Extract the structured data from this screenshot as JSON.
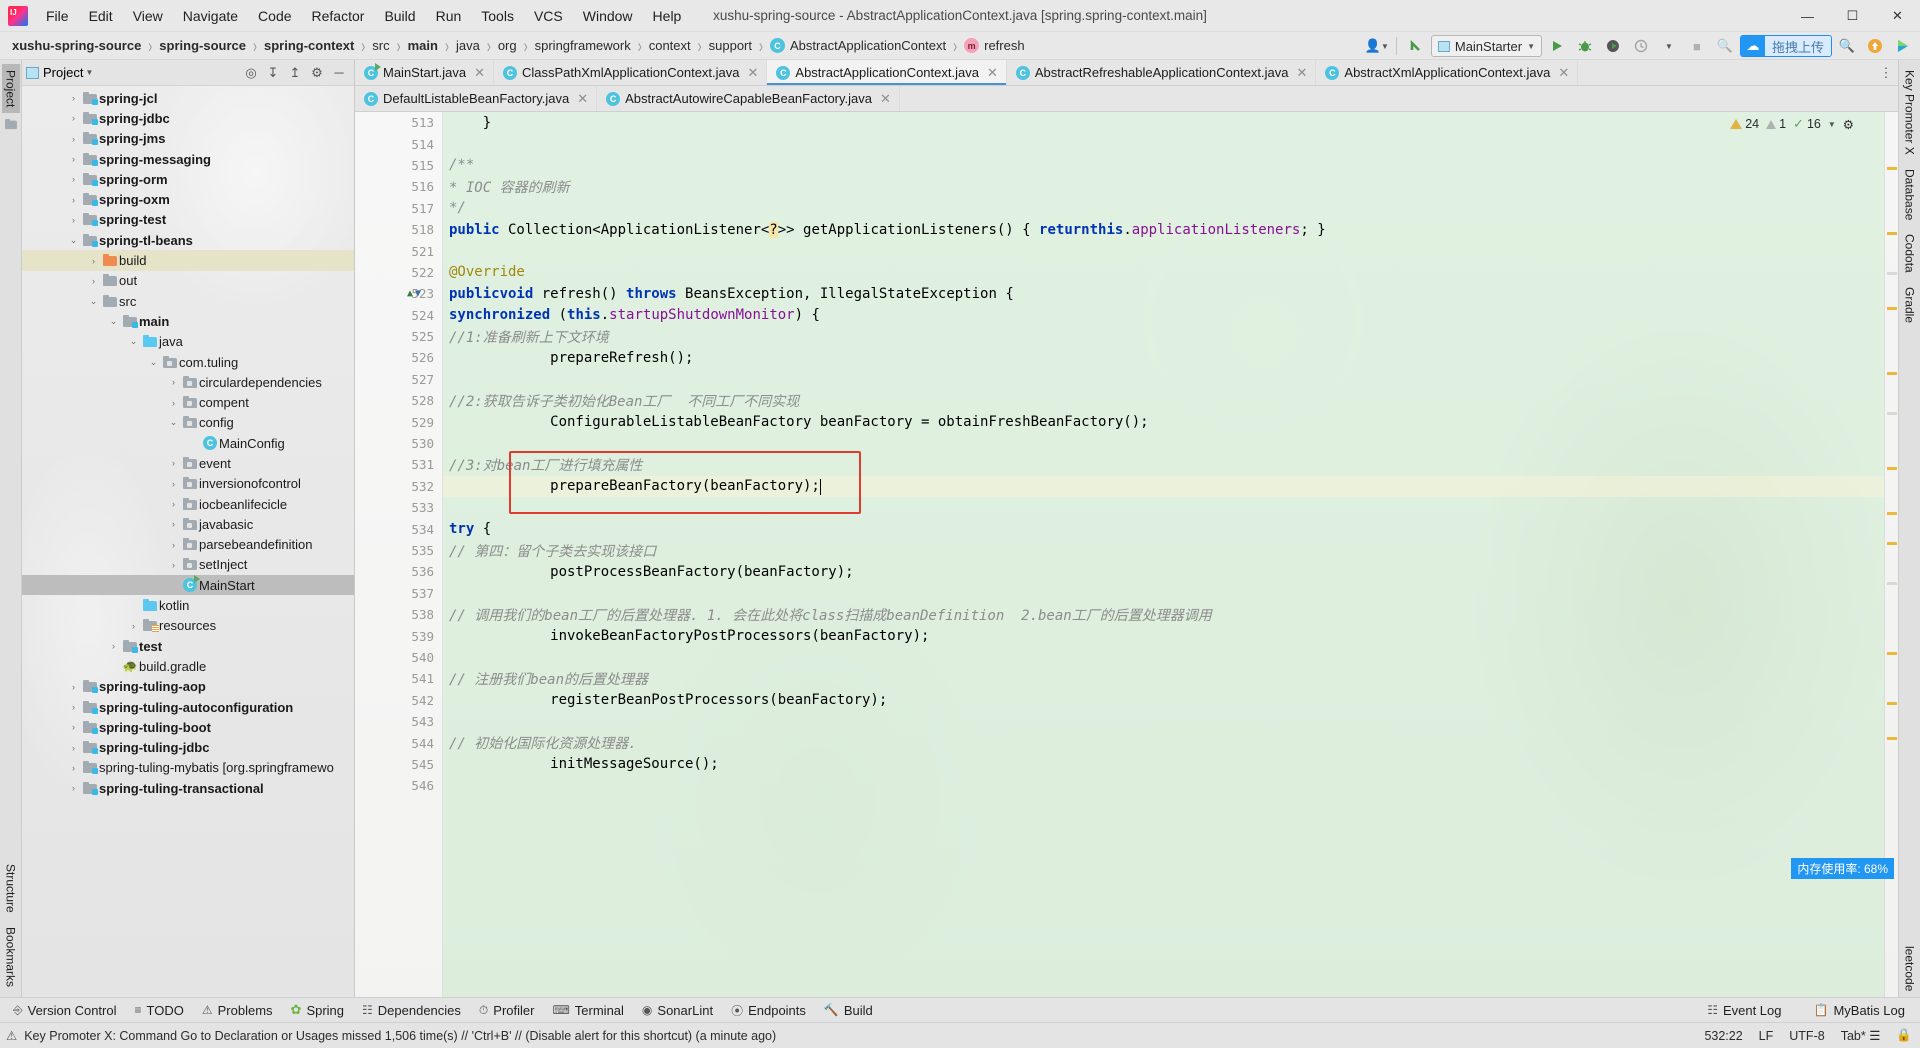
{
  "window": {
    "title": "xushu-spring-source - AbstractApplicationContext.java [spring.spring-context.main]",
    "logo_name": "intellij-idea-logo",
    "minimize": "—",
    "maximize": "☐",
    "close": "✕"
  },
  "menubar": [
    {
      "label": "File"
    },
    {
      "label": "Edit"
    },
    {
      "label": "View"
    },
    {
      "label": "Navigate"
    },
    {
      "label": "Code"
    },
    {
      "label": "Refactor"
    },
    {
      "label": "Build"
    },
    {
      "label": "Run"
    },
    {
      "label": "Tools"
    },
    {
      "label": "VCS"
    },
    {
      "label": "Window"
    },
    {
      "label": "Help"
    }
  ],
  "breadcrumbs": [
    {
      "label": "xushu-spring-source",
      "bold": true,
      "badge": ""
    },
    {
      "label": "spring-source",
      "bold": true,
      "badge": ""
    },
    {
      "label": "spring-context",
      "bold": true,
      "badge": ""
    },
    {
      "label": "src",
      "bold": false,
      "badge": ""
    },
    {
      "label": "main",
      "bold": true,
      "badge": ""
    },
    {
      "label": "java",
      "bold": false,
      "badge": ""
    },
    {
      "label": "org",
      "bold": false,
      "badge": ""
    },
    {
      "label": "springframework",
      "bold": false,
      "badge": ""
    },
    {
      "label": "context",
      "bold": false,
      "badge": ""
    },
    {
      "label": "support",
      "bold": false,
      "badge": ""
    },
    {
      "label": "AbstractApplicationContext",
      "bold": false,
      "badge": "class"
    },
    {
      "label": "refresh",
      "bold": false,
      "badge": "method"
    }
  ],
  "toolbar": {
    "profile_icon": "user-profile-icon",
    "update_icon": "update-project-icon",
    "run_config": "MainStarter",
    "run_icon": "run-icon",
    "debug_icon": "debug-icon",
    "coverage_icon": "run-with-coverage-icon",
    "profiler_icon": "profiler-icon",
    "stop_icon": "stop-icon",
    "search_icon": "search-everywhere-icon",
    "upload_label": "拖拽上传",
    "upload_icon": "cloud-upload-icon",
    "share_icon": "share-icon"
  },
  "project_panel": {
    "title": "Project",
    "icons": {
      "locate": "locate-file-icon",
      "expand": "expand-all-icon",
      "collapse": "collapse-all-icon",
      "settings": "gear-icon",
      "hide": "hide-panel-icon"
    },
    "tree": [
      {
        "label": "spring-jcl",
        "indent": 2,
        "arrow": "›",
        "icon": "module",
        "bold": true,
        "state": ""
      },
      {
        "label": "spring-jdbc",
        "indent": 2,
        "arrow": "›",
        "icon": "module",
        "bold": true,
        "state": ""
      },
      {
        "label": "spring-jms",
        "indent": 2,
        "arrow": "›",
        "icon": "module",
        "bold": true,
        "state": ""
      },
      {
        "label": "spring-messaging",
        "indent": 2,
        "arrow": "›",
        "icon": "module",
        "bold": true,
        "state": ""
      },
      {
        "label": "spring-orm",
        "indent": 2,
        "arrow": "›",
        "icon": "module",
        "bold": true,
        "state": ""
      },
      {
        "label": "spring-oxm",
        "indent": 2,
        "arrow": "›",
        "icon": "module",
        "bold": true,
        "state": ""
      },
      {
        "label": "spring-test",
        "indent": 2,
        "arrow": "›",
        "icon": "module",
        "bold": true,
        "state": ""
      },
      {
        "label": "spring-tl-beans",
        "indent": 2,
        "arrow": "⌄",
        "icon": "module",
        "bold": true,
        "state": ""
      },
      {
        "label": "build",
        "indent": 3,
        "arrow": "›",
        "icon": "build",
        "bold": false,
        "state": "sel-blur"
      },
      {
        "label": "out",
        "indent": 3,
        "arrow": "›",
        "icon": "folder",
        "bold": false,
        "state": ""
      },
      {
        "label": "src",
        "indent": 3,
        "arrow": "⌄",
        "icon": "folder",
        "bold": false,
        "state": ""
      },
      {
        "label": "main",
        "indent": 4,
        "arrow": "⌄",
        "icon": "module",
        "bold": true,
        "state": ""
      },
      {
        "label": "java",
        "indent": 5,
        "arrow": "⌄",
        "icon": "source",
        "bold": false,
        "state": ""
      },
      {
        "label": "com.tuling",
        "indent": 6,
        "arrow": "⌄",
        "icon": "package",
        "bold": false,
        "state": ""
      },
      {
        "label": "circulardependencies",
        "indent": 7,
        "arrow": "›",
        "icon": "package",
        "bold": false,
        "state": ""
      },
      {
        "label": "compent",
        "indent": 7,
        "arrow": "›",
        "icon": "package",
        "bold": false,
        "state": ""
      },
      {
        "label": "config",
        "indent": 7,
        "arrow": "⌄",
        "icon": "package",
        "bold": false,
        "state": ""
      },
      {
        "label": "MainConfig",
        "indent": 8,
        "arrow": "",
        "icon": "class",
        "bold": false,
        "state": ""
      },
      {
        "label": "event",
        "indent": 7,
        "arrow": "›",
        "icon": "package",
        "bold": false,
        "state": ""
      },
      {
        "label": "inversionofcontrol",
        "indent": 7,
        "arrow": "›",
        "icon": "package",
        "bold": false,
        "state": ""
      },
      {
        "label": "iocbeanlifecicle",
        "indent": 7,
        "arrow": "›",
        "icon": "package",
        "bold": false,
        "state": ""
      },
      {
        "label": "javabasic",
        "indent": 7,
        "arrow": "›",
        "icon": "package",
        "bold": false,
        "state": ""
      },
      {
        "label": "parsebeandefinition",
        "indent": 7,
        "arrow": "›",
        "icon": "package",
        "bold": false,
        "state": ""
      },
      {
        "label": "setInject",
        "indent": 7,
        "arrow": "›",
        "icon": "package",
        "bold": false,
        "state": ""
      },
      {
        "label": "MainStart",
        "indent": 7,
        "arrow": "",
        "icon": "runnable-class",
        "bold": false,
        "state": "sel"
      },
      {
        "label": "kotlin",
        "indent": 5,
        "arrow": "",
        "icon": "source",
        "bold": false,
        "state": ""
      },
      {
        "label": "resources",
        "indent": 5,
        "arrow": "›",
        "icon": "resources",
        "bold": false,
        "state": ""
      },
      {
        "label": "test",
        "indent": 4,
        "arrow": "›",
        "icon": "module",
        "bold": true,
        "state": ""
      },
      {
        "label": "build.gradle",
        "indent": 4,
        "arrow": "",
        "icon": "gradle",
        "bold": false,
        "state": ""
      },
      {
        "label": "spring-tuling-aop",
        "indent": 2,
        "arrow": "›",
        "icon": "module",
        "bold": true,
        "state": ""
      },
      {
        "label": "spring-tuling-autoconfiguration",
        "indent": 2,
        "arrow": "›",
        "icon": "module",
        "bold": true,
        "state": ""
      },
      {
        "label": "spring-tuling-boot",
        "indent": 2,
        "arrow": "›",
        "icon": "module",
        "bold": true,
        "state": ""
      },
      {
        "label": "spring-tuling-jdbc",
        "indent": 2,
        "arrow": "›",
        "icon": "module",
        "bold": true,
        "state": ""
      },
      {
        "label": "spring-tuling-mybatis [org.springframewo",
        "indent": 2,
        "arrow": "›",
        "icon": "module",
        "bold": false,
        "state": ""
      },
      {
        "label": "spring-tuling-transactional",
        "indent": 2,
        "arrow": "›",
        "icon": "module",
        "bold": true,
        "state": ""
      }
    ]
  },
  "left_strip": {
    "tabs": [
      "Project"
    ],
    "bottom_tabs": [
      "Structure",
      "Bookmarks"
    ]
  },
  "right_strip": {
    "tabs": [
      "Key Promoter X",
      "Database",
      "Codota",
      "Gradle",
      "leetcode"
    ]
  },
  "editor_tabs": {
    "row1": [
      {
        "label": "MainStart.java",
        "icon": "runnable-class",
        "active": false
      },
      {
        "label": "ClassPathXmlApplicationContext.java",
        "icon": "class",
        "active": false
      },
      {
        "label": "AbstractApplicationContext.java",
        "icon": "class",
        "active": true
      },
      {
        "label": "AbstractRefreshableApplicationContext.java",
        "icon": "class",
        "active": false
      },
      {
        "label": "AbstractXmlApplicationContext.java",
        "icon": "class",
        "active": false
      }
    ],
    "row2": [
      {
        "label": "DefaultListableBeanFactory.java",
        "icon": "class",
        "active": false
      },
      {
        "label": "AbstractAutowireCapableBeanFactory.java",
        "icon": "class",
        "active": false
      }
    ],
    "close_glyph": "✕",
    "more_glyph": "⋮"
  },
  "inspections": {
    "warnings": "24",
    "weak_warnings": "1",
    "ok_count": "16",
    "chevron": "⌄",
    "gear": "⚙"
  },
  "code": {
    "lines": [
      {
        "num": "513",
        "html": "    }",
        "caret": false
      },
      {
        "num": "514",
        "html": "",
        "caret": false
      },
      {
        "num": "515",
        "html": "    <c>/**</c>",
        "caret": false
      },
      {
        "num": "516",
        "html": "     <c>* IOC 容器的刷新</c>",
        "caret": false
      },
      {
        "num": "517",
        "html": "     <c>*/</c>",
        "caret": false
      },
      {
        "num": "518",
        "html": "    <k>public</k> Collection&lt;ApplicationListener&lt;<h>?</h>&gt;&gt; getApplicationListeners() { <k>return</k> <k>this</k>.<f>applicationListeners</f>; }",
        "caret": false
      },
      {
        "num": "521",
        "html": "",
        "caret": false
      },
      {
        "num": "522",
        "html": "    <a>@Override</a>",
        "caret": false
      },
      {
        "num": "523",
        "html": "    <k>public</k> <k>void</k> refresh() <k>throws</k> BeansException, IllegalStateException {",
        "caret": false
      },
      {
        "num": "524",
        "html": "        <k>synchronized</k> (<k>this</k>.<f>startupShutdownMonitor</f>) {",
        "caret": false
      },
      {
        "num": "525",
        "html": "            <c>//1:准备刷新上下文环境</c>",
        "caret": false
      },
      {
        "num": "526",
        "html": "            prepareRefresh();",
        "caret": false
      },
      {
        "num": "527",
        "html": "",
        "caret": false
      },
      {
        "num": "528",
        "html": "            <c>//2:获取告诉子类初始化Bean工厂  不同工厂不同实现</c>",
        "caret": false
      },
      {
        "num": "529",
        "html": "            ConfigurableListableBeanFactory beanFactory = obtainFreshBeanFactory();",
        "caret": false
      },
      {
        "num": "530",
        "html": "",
        "caret": false
      },
      {
        "num": "531",
        "html": "            <c>//3:对bean工厂进行填充属性</c>",
        "caret": false
      },
      {
        "num": "532",
        "html": "            prepareBeanFactory(beanFactory);",
        "caret": true
      },
      {
        "num": "533",
        "html": "",
        "caret": false
      },
      {
        "num": "534",
        "html": "        <k>try</k> {",
        "caret": false
      },
      {
        "num": "535",
        "html": "            <c>// 第四：留个子类去实现该接口</c>",
        "caret": false
      },
      {
        "num": "536",
        "html": "            postProcessBeanFactory(beanFactory);",
        "caret": false
      },
      {
        "num": "537",
        "html": "",
        "caret": false
      },
      {
        "num": "538",
        "html": "            <c>// 调用我们的bean工厂的后置处理器. 1. 会在此处将class扫描成beanDefinition  2.bean工厂的后置处理器调用</c>",
        "caret": false
      },
      {
        "num": "539",
        "html": "            invokeBeanFactoryPostProcessors(beanFactory);",
        "caret": false
      },
      {
        "num": "540",
        "html": "",
        "caret": false
      },
      {
        "num": "541",
        "html": "            <c>// 注册我们bean的后置处理器</c>",
        "caret": false
      },
      {
        "num": "542",
        "html": "            registerBeanPostProcessors(beanFactory);",
        "caret": false
      },
      {
        "num": "543",
        "html": "",
        "caret": false
      },
      {
        "num": "544",
        "html": "            <c>// 初始化国际化资源处理器.</c>",
        "caret": false
      },
      {
        "num": "545",
        "html": "            initMessageSource();",
        "caret": false
      },
      {
        "num": "546",
        "html": "",
        "caret": false
      }
    ]
  },
  "memory_badge": "内存使用率: 68%",
  "bottom_windows": [
    {
      "label": "Version Control",
      "icon": "branch-icon"
    },
    {
      "label": "TODO",
      "icon": "todo-icon"
    },
    {
      "label": "Problems",
      "icon": "problems-icon"
    },
    {
      "label": "Spring",
      "icon": "spring-leaf-icon"
    },
    {
      "label": "Dependencies",
      "icon": "dependencies-icon"
    },
    {
      "label": "Profiler",
      "icon": "profiler-icon"
    },
    {
      "label": "Terminal",
      "icon": "terminal-icon"
    },
    {
      "label": "SonarLint",
      "icon": "sonarlint-icon"
    },
    {
      "label": "Endpoints",
      "icon": "endpoints-icon"
    },
    {
      "label": "Build",
      "icon": "build-icon"
    }
  ],
  "bottom_right_windows": [
    {
      "label": "Event Log",
      "icon": "event-log-icon"
    },
    {
      "label": "MyBatis Log",
      "icon": "mybatis-log-icon"
    }
  ],
  "statusbar": {
    "message": "Key Promoter X: Command Go to Declaration or Usages missed 1,506 time(s) // 'Ctrl+B' // (Disable alert for this shortcut) (a minute ago)",
    "message_icon": "notification-icon",
    "caret_position": "532:22",
    "line_separator": "LF",
    "encoding": "UTF-8",
    "indent": "Tab*",
    "indent_icon": "indent-icon",
    "lock_icon": "lock-icon"
  },
  "colors": {
    "accent": "#4a90d9",
    "tab_active_underline": "#4a90d9",
    "red_highlight": "#e03b2f",
    "keyword": "#0033b3",
    "comment": "#8c8c8c",
    "annotation": "#9e880d",
    "field": "#871094",
    "code_bg_tint": "#c6e6c8",
    "upload_blue": "#2196f3",
    "selection_grey": "#bdbdbd",
    "selection_yellow": "#e6e4c8"
  }
}
